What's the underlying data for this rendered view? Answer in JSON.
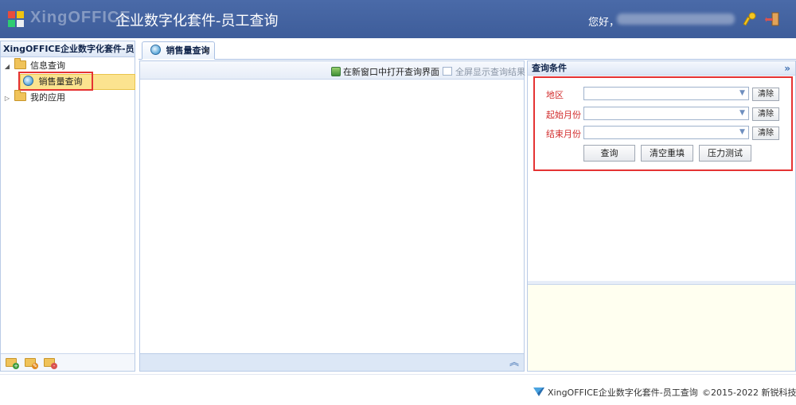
{
  "header": {
    "brand_watermark": "XingOFFICE",
    "title": "企业数字化套件-员工查询",
    "greeting": "您好，"
  },
  "sidebar": {
    "title": "XingOFFICE企业数字化套件-员工查",
    "tree": [
      {
        "label": "信息查询",
        "expanded": true,
        "children": [
          {
            "label": "销售量查询",
            "selected": true
          }
        ]
      },
      {
        "label": "我的应用",
        "expanded": false
      }
    ]
  },
  "tabs": [
    {
      "label": "销售量查询",
      "close": "×"
    }
  ],
  "center": {
    "toolbar": {
      "open_new_window": "在新窗口中打开查询界面",
      "fullscreen_results": "全屏显示查询结果"
    }
  },
  "query_panel": {
    "title": "查询条件",
    "collapse_icon": "»",
    "fields": [
      {
        "label": "地区",
        "clear": "清除"
      },
      {
        "label": "起始月份",
        "clear": "清除"
      },
      {
        "label": "结束月份",
        "clear": "清除"
      }
    ],
    "buttons": {
      "query": "查询",
      "reset": "清空重填",
      "stress_test": "压力测试"
    }
  },
  "footer": {
    "product": "XingOFFICE企业数字化套件-员工查询",
    "separator": "|",
    "copyright": "©2015-2022 新锐科技"
  },
  "colors": {
    "header_bg": "#4264a3",
    "highlight": "#e53333",
    "selected_bg": "#fbe38f"
  }
}
